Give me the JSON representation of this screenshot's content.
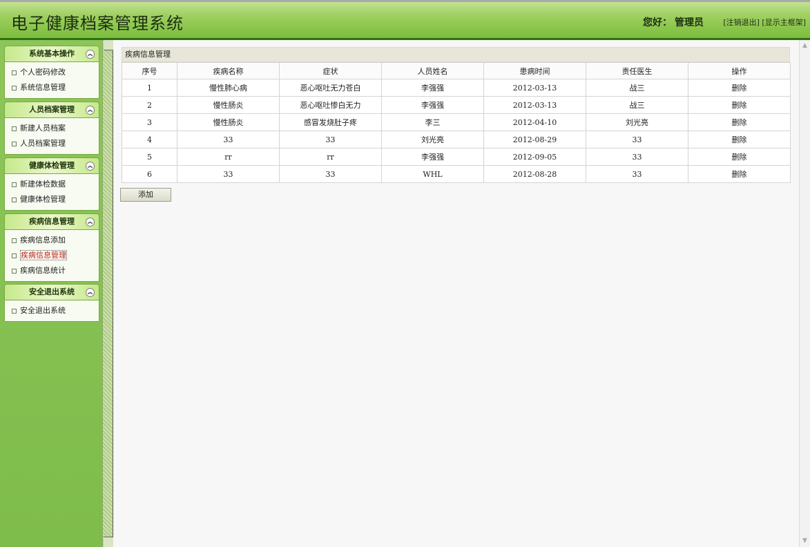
{
  "header": {
    "title": "电子健康档案管理系统",
    "greeting_label": "您好：",
    "user_name": "管理员",
    "logout_link": "[注销退出]",
    "show_frame_link": "[显示主框架]"
  },
  "sidebar": {
    "groups": [
      {
        "title": "系统基本操作",
        "items": [
          "个人密码修改",
          "系统信息管理"
        ]
      },
      {
        "title": "人员档案管理",
        "items": [
          "新建人员档案",
          "人员档案管理"
        ]
      },
      {
        "title": "健康体检管理",
        "items": [
          "新建体检数据",
          "健康体检管理"
        ]
      },
      {
        "title": "疾病信息管理",
        "items": [
          "疾病信息添加",
          "疾病信息管理",
          "疾病信息统计"
        ]
      },
      {
        "title": "安全退出系统",
        "items": [
          "安全退出系统"
        ]
      }
    ],
    "active_item": "疾病信息管理"
  },
  "main": {
    "panel_title": "疾病信息管理",
    "columns": [
      "序号",
      "疾病名称",
      "症状",
      "人员姓名",
      "患病时间",
      "责任医生",
      "操作"
    ],
    "rows": [
      [
        "1",
        "慢性肺心病",
        "恶心呕吐无力苍白",
        "李强强",
        "2012-03-13",
        "战三",
        "删除"
      ],
      [
        "2",
        "慢性肠炎",
        "恶心呕吐惨白无力",
        "李强强",
        "2012-03-13",
        "战三",
        "删除"
      ],
      [
        "3",
        "慢性肠炎",
        "感冒发烧肚子疼",
        "李三",
        "2012-04-10",
        "刘光亮",
        "删除"
      ],
      [
        "4",
        "33",
        "33",
        "刘光亮",
        "2012-08-29",
        "33",
        "删除"
      ],
      [
        "5",
        "rr",
        "rr",
        "李强强",
        "2012-09-05",
        "33",
        "删除"
      ],
      [
        "6",
        "33",
        "33",
        "WHL",
        "2012-08-28",
        "33",
        "删除"
      ]
    ],
    "add_label": "添加"
  },
  "colors": {
    "header_green": "#7bbd3c",
    "sidebar_green": "#8cc65a",
    "active_link": "#c0241b"
  }
}
